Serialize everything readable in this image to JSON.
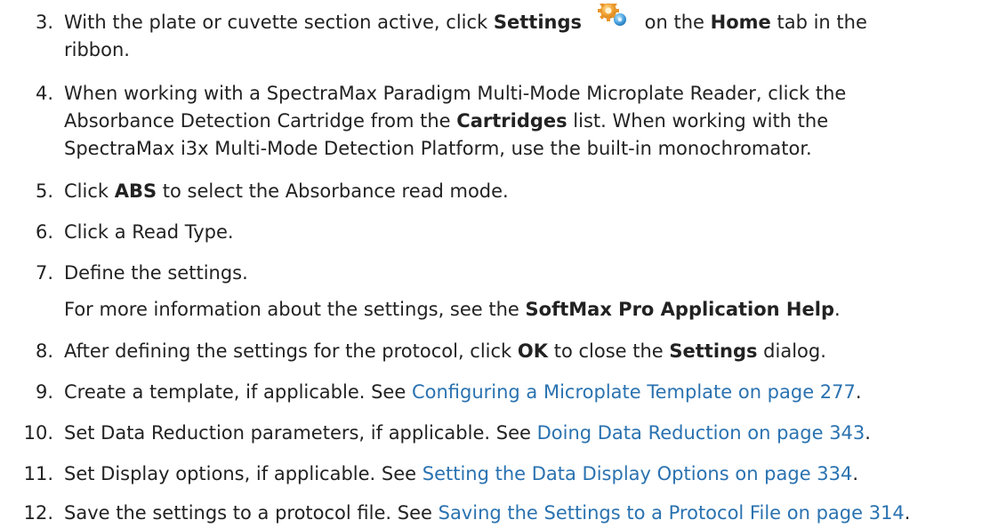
{
  "steps": [
    {
      "number": "3.",
      "lines": [
        {
          "before": "With the plate or cuvette section active, click ",
          "b1": "Settings",
          "mid": " on the ",
          "b2": "Home",
          "after": " tab in the"
        },
        {
          "text": "ribbon."
        }
      ]
    },
    {
      "number": "4.",
      "lines": [
        {
          "text": "When working with a SpectraMax Paradigm Multi-Mode Microplate Reader, click the"
        },
        {
          "before": "Absorbance Detection Cartridge from the ",
          "bold": "Cartridges",
          "after": " list. When working with the"
        },
        {
          "text": "SpectraMax i3x Multi-Mode Detection Platform, use the built-in monochromator."
        }
      ]
    },
    {
      "number": "5.",
      "before": "Click ",
      "bold": "ABS",
      "after": " to select the Absorbance read mode."
    },
    {
      "number": "6.",
      "text": "Click a Read Type."
    },
    {
      "number": "7.",
      "text": "Define the settings.",
      "note": {
        "before": "For more information about the settings, see the ",
        "bold": "SoftMax Pro Application Help",
        "after": "."
      }
    },
    {
      "number": "8.",
      "before": "After defining the settings for the protocol, click ",
      "b1": "OK",
      "mid": " to close the ",
      "b2": "Settings",
      "after": " dialog."
    },
    {
      "number": "9.",
      "before": "Create a template, if applicable. See ",
      "link": "Configuring a Microplate Template on page 277",
      "after": "."
    },
    {
      "number": "10.",
      "before": "Set Data Reduction parameters, if applicable. See ",
      "link": "Doing Data Reduction on page 343",
      "after": "."
    },
    {
      "number": "11.",
      "before": "Set Display options, if applicable. See ",
      "link": "Setting the Data Display Options on page 334",
      "after": "."
    },
    {
      "number": "12.",
      "before": "Save the settings to a protocol file. See ",
      "link": "Saving the Settings to a Protocol File on page 314",
      "after": "."
    }
  ],
  "colors": {
    "text": "#222222",
    "link": "#2a72b0"
  },
  "icons": {
    "settings": "gears-icon"
  }
}
